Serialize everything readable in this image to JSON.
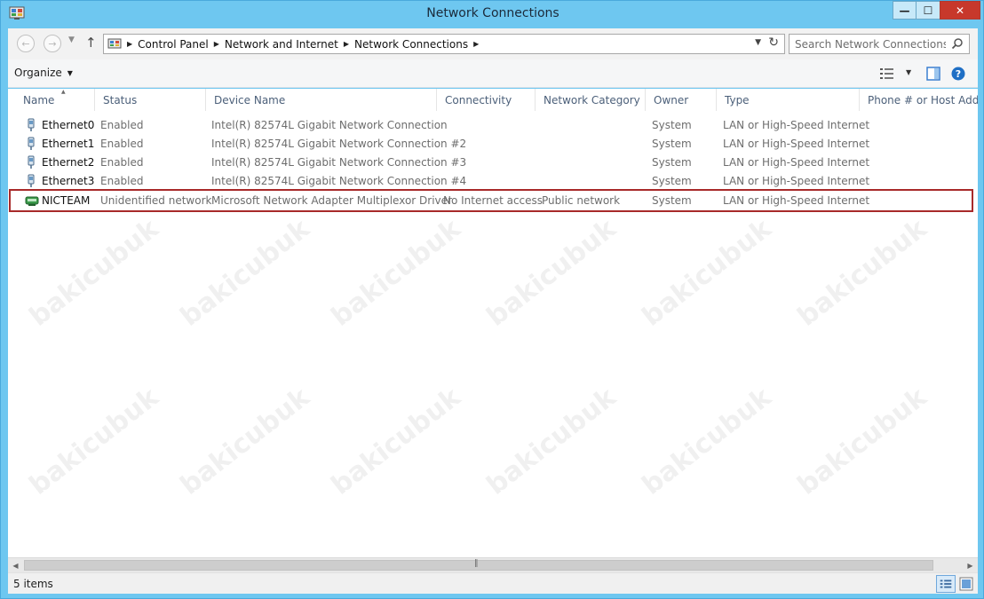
{
  "window": {
    "title": "Network Connections"
  },
  "window_buttons": {
    "minimize": "—",
    "maximize": "☐",
    "close": "✕"
  },
  "navigation": {
    "back_icon": "back-arrow-icon",
    "forward_icon": "forward-arrow-icon",
    "up_icon": "up-arrow-icon",
    "breadcrumbs": [
      "Control Panel",
      "Network and Internet",
      "Network Connections"
    ],
    "search_placeholder": "Search Network Connections"
  },
  "toolbar": {
    "organize_label": "Organize"
  },
  "columns": [
    {
      "label": "Name"
    },
    {
      "label": "Status"
    },
    {
      "label": "Device Name"
    },
    {
      "label": "Connectivity"
    },
    {
      "label": "Network Category"
    },
    {
      "label": "Owner"
    },
    {
      "label": "Type"
    },
    {
      "label": "Phone # or Host Address"
    }
  ],
  "rows": [
    {
      "name": "Ethernet0",
      "status": "Enabled",
      "device": "Intel(R) 82574L Gigabit Network Connection",
      "connectivity": "",
      "category": "",
      "owner": "System",
      "type": "LAN or High-Speed Internet",
      "icon": "ethernet-adapter-icon"
    },
    {
      "name": "Ethernet1",
      "status": "Enabled",
      "device": "Intel(R) 82574L Gigabit Network Connection #2",
      "connectivity": "",
      "category": "",
      "owner": "System",
      "type": "LAN or High-Speed Internet",
      "icon": "ethernet-adapter-icon"
    },
    {
      "name": "Ethernet2",
      "status": "Enabled",
      "device": "Intel(R) 82574L Gigabit Network Connection #3",
      "connectivity": "",
      "category": "",
      "owner": "System",
      "type": "LAN or High-Speed Internet",
      "icon": "ethernet-adapter-icon"
    },
    {
      "name": "Ethernet3",
      "status": "Enabled",
      "device": "Intel(R) 82574L Gigabit Network Connection #4",
      "connectivity": "",
      "category": "",
      "owner": "System",
      "type": "LAN or High-Speed Internet",
      "icon": "ethernet-adapter-icon"
    },
    {
      "name": "NICTEAM",
      "status": "Unidentified network",
      "device": "Microsoft Network Adapter Multiplexor Driver",
      "connectivity": "No Internet access",
      "category": "Public network",
      "owner": "System",
      "type": "LAN or High-Speed Internet",
      "icon": "network-team-icon",
      "highlighted": true
    }
  ],
  "watermark_text": "bakicubuk",
  "status": {
    "item_count": "5 items"
  },
  "colors": {
    "window_frame": "#6ec7f0",
    "highlight_border": "#a82a2a",
    "close_button": "#c7382b"
  }
}
